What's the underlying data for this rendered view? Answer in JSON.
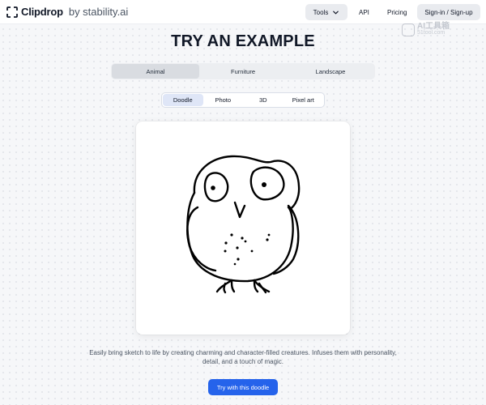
{
  "header": {
    "brand": "Clipdrop",
    "brand_suffix": "by stability.ai",
    "nav": {
      "tools_label": "Tools",
      "api_label": "API",
      "pricing_label": "Pricing",
      "signin_label": "Sign-in / Sign-up"
    }
  },
  "watermark": {
    "line1": "AI工具箱",
    "line2": "51tool.com"
  },
  "main": {
    "title": "TRY AN EXAMPLE",
    "category_tabs": [
      {
        "label": "Animal",
        "active": true
      },
      {
        "label": "Furniture",
        "active": false
      },
      {
        "label": "Landscape",
        "active": false
      }
    ],
    "type_tabs": [
      {
        "label": "Doodle",
        "active": true
      },
      {
        "label": "Photo",
        "active": false
      },
      {
        "label": "3D",
        "active": false
      },
      {
        "label": "Pixel art",
        "active": false
      }
    ],
    "description": "Easily bring sketch to life by creating charming and character-filled creatures. Infuses them with personality, detail, and a touch of magic.",
    "cta_label": "Try with this doodle"
  },
  "colors": {
    "accent": "#2563eb",
    "background": "#f6f7f9",
    "active_type_tab": "#dfe6f7"
  },
  "icons": {
    "logo": "clipdrop-logo-icon",
    "tools_dropdown": "chevron-down-icon",
    "doodle": "owl-doodle-image"
  }
}
